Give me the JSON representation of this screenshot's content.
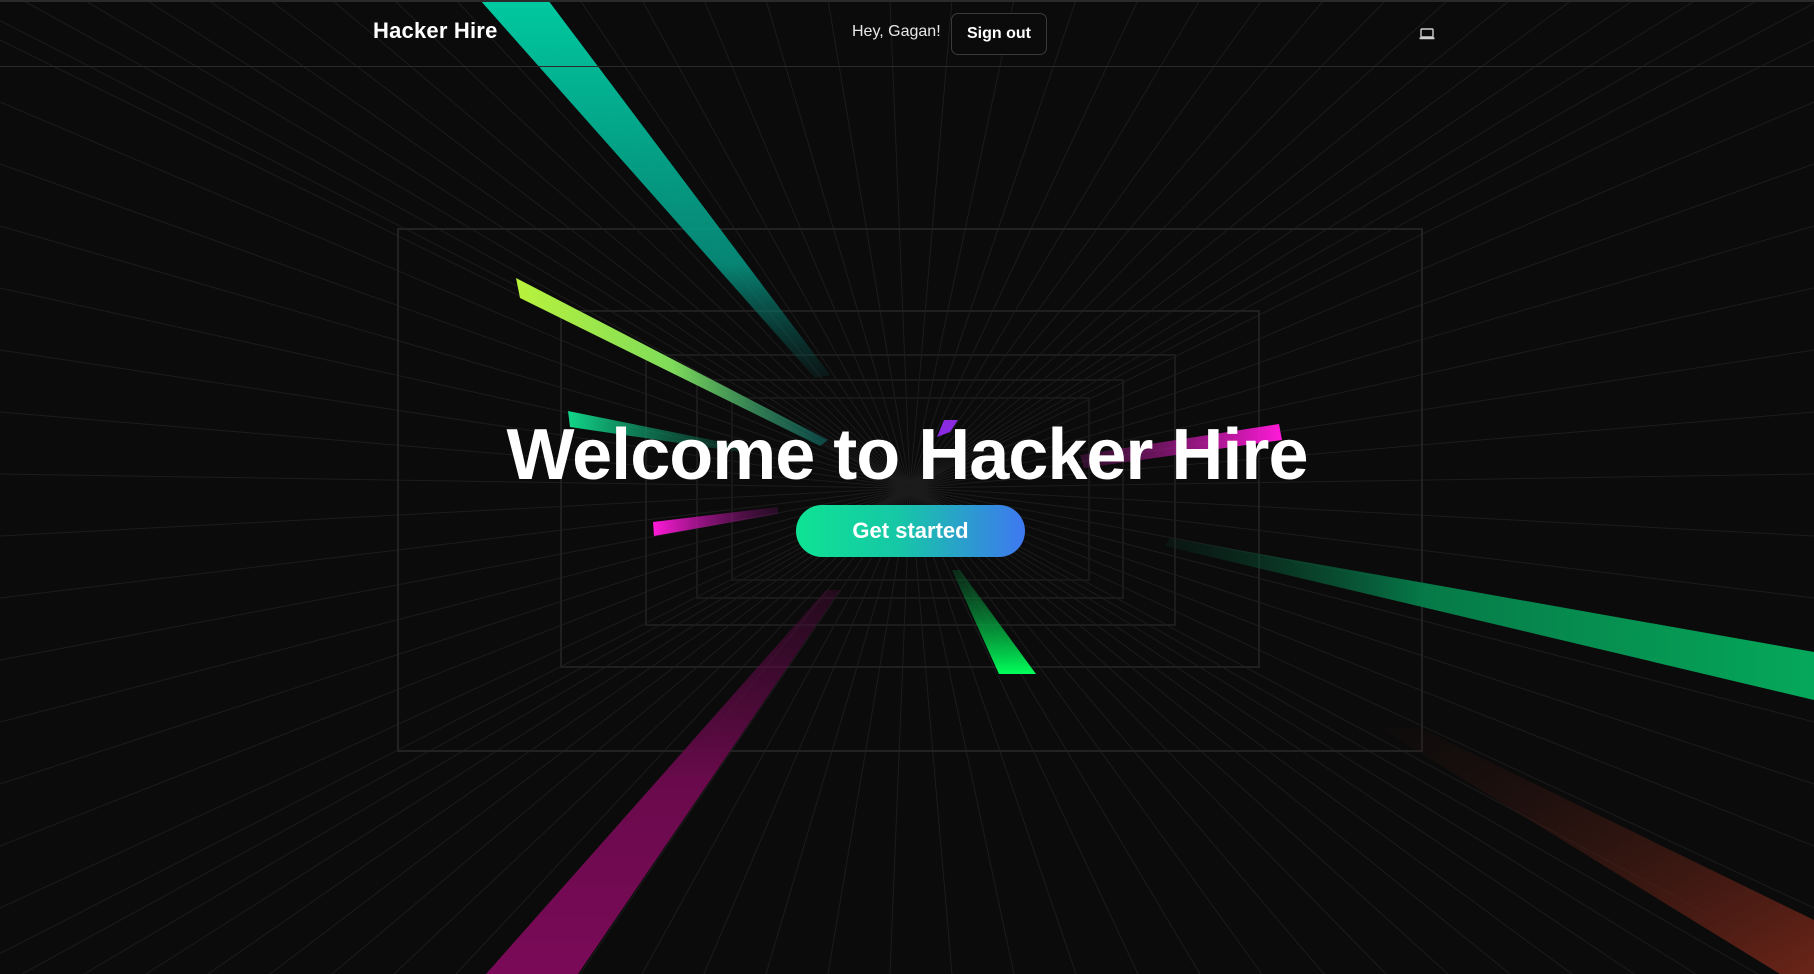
{
  "header": {
    "brand": "Hacker Hire",
    "greeting": "Hey, Gagan!",
    "sign_out_label": "Sign out",
    "theme_toggle_icon": "laptop-icon"
  },
  "hero": {
    "title": "Welcome to Hacker Hire",
    "cta_label": "Get started"
  },
  "colors": {
    "background": "#0b0b0b",
    "cta_gradient_start": "#0ee394",
    "cta_gradient_end": "#3e78f1",
    "accent_teal": "#00c9a0",
    "accent_lime": "#b2f03c",
    "accent_magenta": "#ff1ad9",
    "accent_green": "#00e65a",
    "accent_purple": "#8a2be2"
  }
}
